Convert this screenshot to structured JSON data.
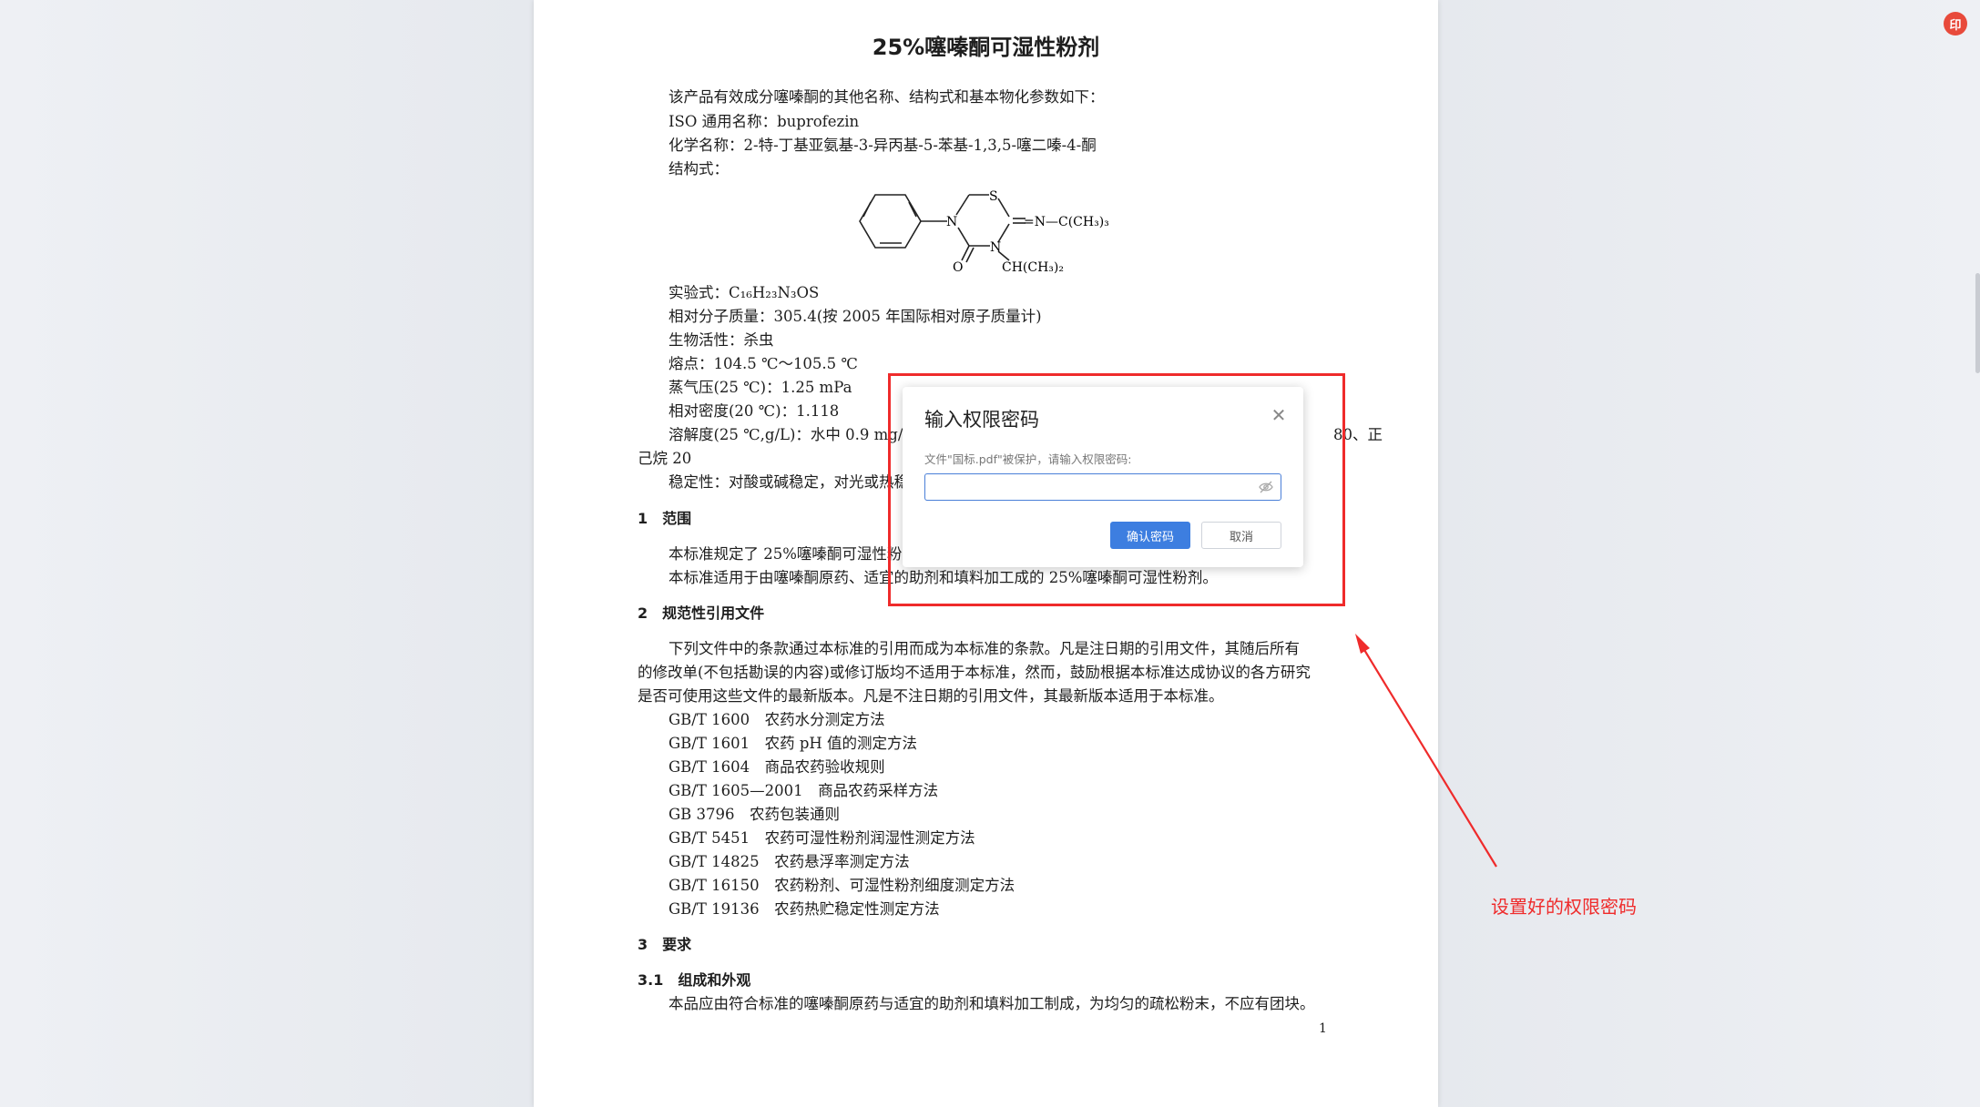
{
  "document": {
    "title": "25%噻嗪酮可湿性粉剂",
    "intro": [
      "该产品有效成分噻嗪酮的其他名称、结构式和基本物化参数如下：",
      "ISO 通用名称：buprofezin",
      "化学名称：2-特-丁基亚氨基-3-异丙基-5-苯基-1,3,5-噻二嗪-4-酮",
      "结构式："
    ],
    "structure": {
      "atom_s": "S",
      "atom_n1": "N",
      "atom_n2": "N",
      "atom_o": "O",
      "sub_right": "=N—C(CH₃)₃",
      "sub_bottom": "CH(CH₃)₂"
    },
    "formula_label": "实验式：",
    "formula": "C₁₆H₂₃N₃OS",
    "properties": [
      "相对分子质量：305.4(按 2005 年国际相对原子质量计)",
      "生物活性：杀虫",
      "熔点：104.5 ℃～105.5 ℃",
      "蒸气压(25 ℃)：1.25 mPa",
      "相对密度(20 ℃)：1.118"
    ],
    "solubility_line1a": "溶解度(25 ℃,g/L)：水中 0.9 mg/",
    "solubility_line1b": "80、正",
    "solubility_line2": "己烷 20",
    "stability": "稳定性：对酸或碱稳定，对光或热稳",
    "section1_heading": "1　范围",
    "section1_para1": "本标准规定了 25%噻嗪酮可湿性粉",
    "section1_para2": "本标准适用于由噻嗪酮原药、适宜的助剂和填料加工成的 25%噻嗪酮可湿性粉剂。",
    "section2_heading": "2　规范性引用文件",
    "section2_para": [
      "下列文件中的条款通过本标准的引用而成为本标准的条款。凡是注日期的引用文件，其随后所有",
      "的修改单(不包括勘误的内容)或修订版均不适用于本标准，然而，鼓励根据本标准达成协议的各方研究",
      "是否可使用这些文件的最新版本。凡是不注日期的引用文件，其最新版本适用于本标准。"
    ],
    "references": [
      "GB/T 1600　农药水分测定方法",
      "GB/T 1601　农药 pH 值的测定方法",
      "GB/T 1604　商品农药验收规则",
      "GB/T 1605—2001　商品农药采样方法",
      "GB 3796　农药包装通则",
      "GB/T 5451　农药可湿性粉剂润湿性测定方法",
      "GB/T 14825　农药悬浮率测定方法",
      "GB/T 16150　农药粉剂、可湿性粉剂细度测定方法",
      "GB/T 19136　农药热贮稳定性测定方法"
    ],
    "section3_heading": "3　要求",
    "section31_heading": "3.1　组成和外观",
    "section31_para": "本品应由符合标准的噻嗪酮原药与适宜的助剂和填料加工制成，为均匀的疏松粉末，不应有团块。",
    "page_number": "1"
  },
  "dialog": {
    "title": "输入权限密码",
    "message": "文件\"国标.pdf\"被保护，请输入权限密码:",
    "password_value": "",
    "confirm_label": "确认密码",
    "cancel_label": "取消"
  },
  "annotation": {
    "text": "设置好的权限密码",
    "color": "#ef2b2b"
  },
  "app": {
    "corner_logo_text": "印"
  },
  "colors": {
    "accent": "#3d7ee0",
    "highlight": "#ef2b2b"
  }
}
